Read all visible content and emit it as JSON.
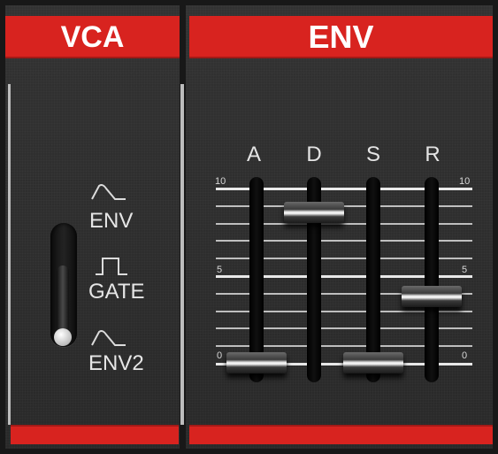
{
  "vca": {
    "title": "VCA",
    "switch_options": [
      {
        "label": "ENV",
        "icon": "envelope-wave-icon"
      },
      {
        "label": "GATE",
        "icon": "gate-pulse-icon"
      },
      {
        "label": "ENV2",
        "icon": "envelope2-wave-icon"
      }
    ],
    "selected": "ENV2"
  },
  "env": {
    "title": "ENV",
    "scale": {
      "max_label": "10",
      "mid_label": "5",
      "min_label": "0"
    },
    "sliders": [
      {
        "label": "A",
        "value": 0
      },
      {
        "label": "D",
        "value": 8.6
      },
      {
        "label": "S",
        "value": 0
      },
      {
        "label": "R",
        "value": 3.8
      }
    ]
  },
  "colors": {
    "header_red": "#d8231f",
    "panel": "#2e2e2e",
    "text": "#e6e6e6"
  }
}
